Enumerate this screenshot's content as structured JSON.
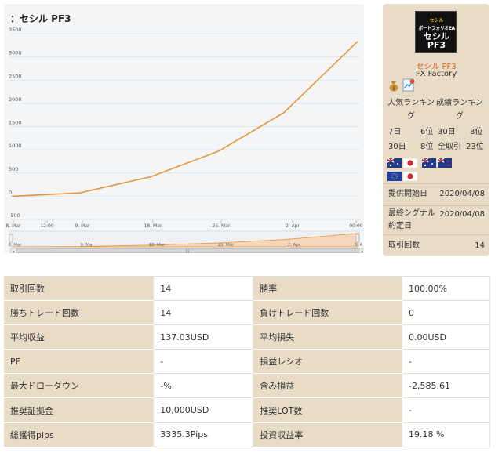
{
  "chart": {
    "title": "：セシル PF3"
  },
  "chart_data": {
    "type": "line",
    "series": [
      {
        "values": [
          [
            0,
            0
          ],
          [
            0.9,
            70
          ],
          [
            1.85,
            420
          ],
          [
            2.75,
            970
          ],
          [
            3.62,
            1800
          ],
          [
            4.6,
            3335
          ]
        ]
      }
    ],
    "ylim": [
      -500,
      3500
    ],
    "y_ticks": [
      "3500",
      "3000",
      "2500",
      "2000",
      "1500",
      "1000",
      "500",
      "0",
      "-500"
    ],
    "x_ticks": [
      "8. Mar",
      "12:00",
      "9. Mar",
      "18. Mar",
      "25. Mar",
      "2. Apr",
      "00:00"
    ],
    "navigator_ticks": [
      "8. Mar",
      "9. Mar",
      "18. Mar",
      "25. Mar",
      "2. Apr",
      "8. A"
    ],
    "grid": true,
    "line_color": "#e8963a"
  },
  "product": {
    "thumb_line1": "セシル",
    "thumb_line2": "ポートフォリオEA",
    "thumb_line3a": "セシル",
    "thumb_line3b": "PF3",
    "name": "セシル PF3",
    "vendor": "FX Factory",
    "rank_head_left": "人気ランキング",
    "rank_head_right": "成績ランキング",
    "ranks": {
      "r1_period_left": "7日",
      "r1_rank_left": "6位",
      "r1_period_right": "30日",
      "r1_rank_right": "8位",
      "r2_period_left": "30日",
      "r2_rank_left": "8位",
      "r2_period_right": "全取引",
      "r2_rank_right": "23位"
    },
    "start_label": "提供開始日",
    "start_value": "2020/04/08",
    "last_signal_label": "最終シグナル約定日",
    "last_signal_value": "2020/04/08",
    "trades_label": "取引回数",
    "trades_value": "14"
  },
  "stats": [
    {
      "l1": "取引回数",
      "v1": "14",
      "l2": "勝率",
      "v2": "100.00%"
    },
    {
      "l1": "勝ちトレード回数",
      "v1": "14",
      "l2": "負けトレード回数",
      "v2": "0"
    },
    {
      "l1": "平均収益",
      "v1": "137.03USD",
      "l2": "平均損失",
      "v2": "0.00USD"
    },
    {
      "l1": "PF",
      "v1": "-",
      "l2": "損益レシオ",
      "v2": "-"
    },
    {
      "l1": "最大ドローダウン",
      "v1": "-%",
      "l2": "含み損益",
      "v2": "-2,585.61"
    },
    {
      "l1": "推奨証拠金",
      "v1": "10,000USD",
      "l2": "推奨LOT数",
      "v2": "-"
    },
    {
      "l1": "総獲得pips",
      "v1": "3335.3Pips",
      "l2": "投資収益率",
      "v2": "19.18 %"
    }
  ]
}
